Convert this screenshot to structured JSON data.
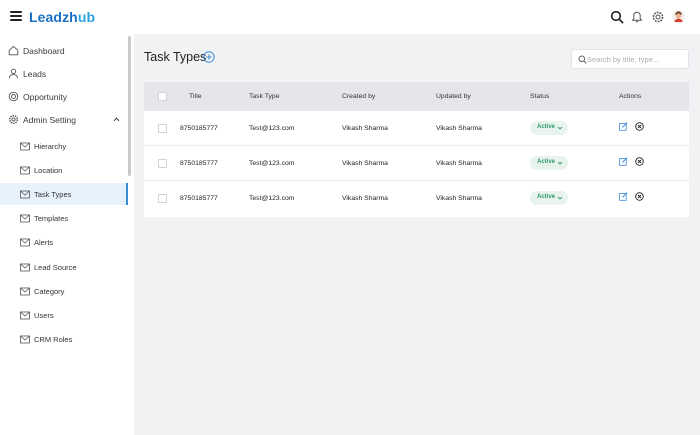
{
  "app": {
    "logo_prefix": "Leadzh",
    "logo_accent": "ub",
    "brand_color": "#1a6fc4",
    "accent_color": "#29a3e0"
  },
  "topbar": {
    "icons": [
      "search-icon",
      "bell-icon",
      "gear-icon",
      "user-avatar"
    ]
  },
  "sidebar": {
    "items": [
      {
        "label": "Dashboard",
        "icon": "home-icon"
      },
      {
        "label": "Leads",
        "icon": "user-icon"
      },
      {
        "label": "Opportunity",
        "icon": "opportunity-icon"
      },
      {
        "label": "Admin Setting",
        "icon": "gear-icon",
        "expanded": true
      }
    ],
    "sub_items": [
      {
        "label": "Hierarchy",
        "icon": "mail-icon"
      },
      {
        "label": "Location",
        "icon": "mail-icon"
      },
      {
        "label": "Task Types",
        "icon": "mail-icon",
        "active": true
      },
      {
        "label": "Templates",
        "icon": "mail-icon"
      },
      {
        "label": "Alerts",
        "icon": "mail-icon"
      },
      {
        "label": "Lead Source",
        "icon": "mail-icon"
      },
      {
        "label": "Category",
        "icon": "mail-icon"
      },
      {
        "label": "Users",
        "icon": "mail-icon"
      },
      {
        "label": "CRM Roles",
        "icon": "mail-icon"
      }
    ]
  },
  "main": {
    "title": "Task Types",
    "search_placeholder": "Search by title, type...",
    "columns": [
      "Title",
      "Task Type",
      "Created by",
      "Updated by",
      "Status",
      "Actions"
    ],
    "rows": [
      {
        "title": "8750185777",
        "task_type": "Test@123.com",
        "created_by": "Vikash Sharma",
        "updated_by": "Vikash Sharma",
        "status": "Active"
      },
      {
        "title": "8750185777",
        "task_type": "Test@123.com",
        "created_by": "Vikash Sharma",
        "updated_by": "Vikash Sharma",
        "status": "Active"
      },
      {
        "title": "8750185777",
        "task_type": "Test@123.com",
        "created_by": "Vikash Sharma",
        "updated_by": "Vikash Sharma",
        "status": "Active"
      }
    ],
    "status_color": "#2e9b6a",
    "edit_color": "#3b8ad8"
  }
}
